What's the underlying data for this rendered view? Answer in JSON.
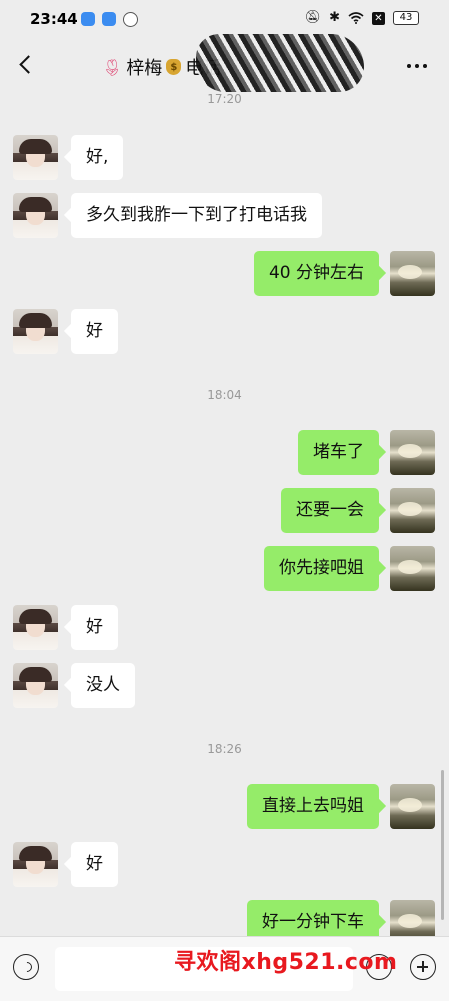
{
  "status_bar": {
    "time": "23:44",
    "battery": "43",
    "icons": [
      "app-icon",
      "app-icon",
      "app-icon",
      "mute-icon",
      "bluetooth-icon",
      "wifi-icon",
      "sim-off-icon",
      "battery-icon"
    ]
  },
  "header": {
    "title_prefix_icon": "tulip-icon",
    "title": "梓梅",
    "title_suffix_icon": "money-bag-icon",
    "title_tail": "电话",
    "back_icon": "chevron-left-icon",
    "more_icon": "more-icon"
  },
  "messages": [
    {
      "type": "time",
      "text": "17:20"
    },
    {
      "side": "left",
      "text": "好,"
    },
    {
      "side": "left",
      "text": "多久到我胙一下到了打电话我"
    },
    {
      "side": "right",
      "text": "40 分钟左右"
    },
    {
      "side": "left",
      "text": "好"
    },
    {
      "type": "time",
      "text": "18:04"
    },
    {
      "side": "right",
      "text": "堵车了"
    },
    {
      "side": "right",
      "text": "还要一会"
    },
    {
      "side": "right",
      "text": "你先接吧姐"
    },
    {
      "side": "left",
      "text": "好"
    },
    {
      "side": "left",
      "text": "没人"
    },
    {
      "type": "time",
      "text": "18:26"
    },
    {
      "side": "right",
      "text": "直接上去吗姐"
    },
    {
      "side": "left",
      "text": "好"
    },
    {
      "side": "right",
      "text": "好一分钟下车"
    }
  ],
  "input_bar": {
    "placeholder": "",
    "icons": [
      "voice-icon",
      "emoji-icon",
      "plus-icon"
    ]
  },
  "watermark": "寻欢阁xhg521.com",
  "colors": {
    "background": "#ededed",
    "own_bubble": "#95ec69",
    "other_bubble": "#ffffff",
    "watermark": "#e8191f"
  }
}
